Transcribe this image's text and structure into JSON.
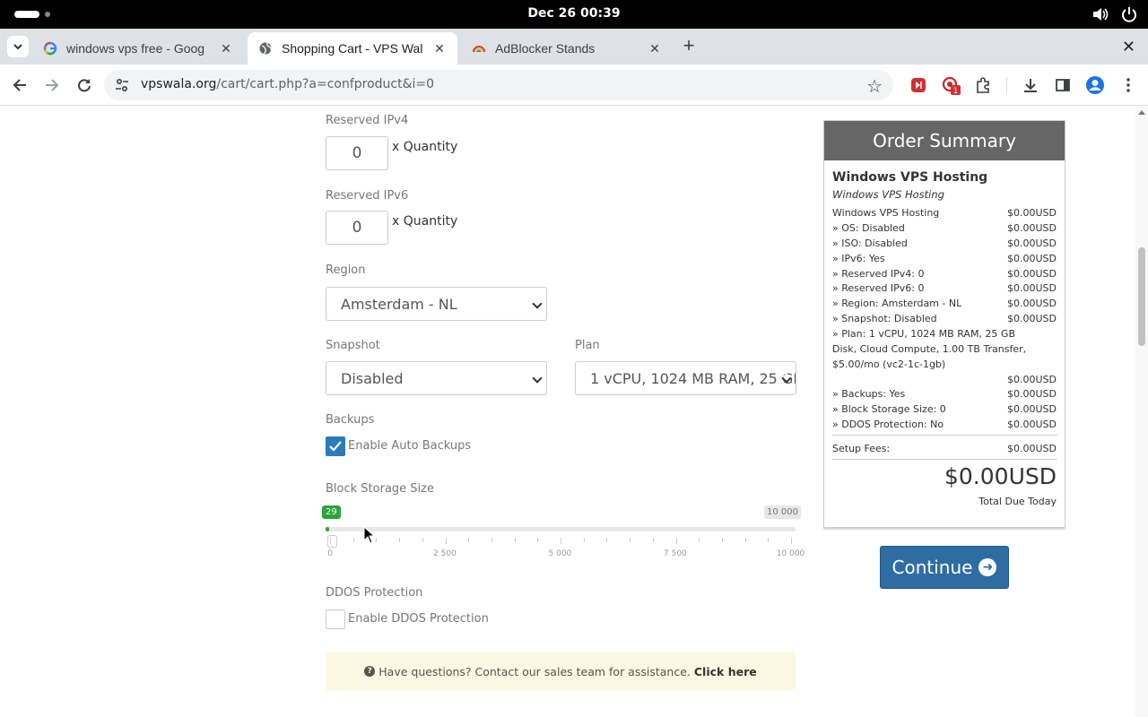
{
  "os": {
    "clock": "Dec 26  00:39"
  },
  "tabs": [
    {
      "title": "windows vps free - Goog",
      "icon": "google-icon"
    },
    {
      "title": "Shopping Cart - VPS Wal",
      "icon": "globe-icon"
    },
    {
      "title": "AdBlocker Stands",
      "icon": "rainbow-icon"
    }
  ],
  "toolbar": {
    "url_host": "vpswala.org",
    "url_path": "/cart/cart.php?a=confproduct&i=0",
    "badge_count": "1"
  },
  "form": {
    "reserved_ipv4": {
      "label": "Reserved IPv4",
      "value": "0",
      "suffix": "x Quantity"
    },
    "reserved_ipv6": {
      "label": "Reserved IPv6",
      "value": "0",
      "suffix": "x Quantity"
    },
    "region": {
      "label": "Region",
      "selected": "Amsterdam - NL"
    },
    "snapshot": {
      "label": "Snapshot",
      "selected": "Disabled"
    },
    "plan": {
      "label": "Plan",
      "selected": "1 vCPU, 1024 MB RAM, 25 GB Disk"
    },
    "backups": {
      "label": "Backups",
      "checkbox_label": "Enable Auto Backups",
      "checked": true
    },
    "block_storage": {
      "label": "Block Storage Size",
      "value": "29",
      "value_num": 29,
      "max_label": "10 000",
      "max_num": 10000,
      "ticks": [
        "0",
        "2 500",
        "5 000",
        "7 500",
        "10 000"
      ]
    },
    "ddos": {
      "label": "DDOS Protection",
      "checkbox_label": "Enable DDOS Protection",
      "checked": false
    }
  },
  "help": {
    "text": "Have questions? Contact our sales team for assistance.",
    "link": "Click here"
  },
  "summary": {
    "title": "Order Summary",
    "product_name": "Windows VPS Hosting",
    "product_group": "Windows VPS Hosting",
    "lines": [
      {
        "desc": "Windows VPS Hosting",
        "price": "$0.00USD"
      },
      {
        "desc": " » OS: Disabled",
        "price": "$0.00USD"
      },
      {
        "desc": " » ISO: Disabled",
        "price": "$0.00USD"
      },
      {
        "desc": " » IPv6: Yes",
        "price": "$0.00USD"
      },
      {
        "desc": " » Reserved IPv4: 0",
        "price": "$0.00USD"
      },
      {
        "desc": " » Reserved IPv6: 0",
        "price": "$0.00USD"
      },
      {
        "desc": " » Region: Amsterdam - NL",
        "price": "$0.00USD"
      },
      {
        "desc": " » Snapshot: Disabled",
        "price": "$0.00USD"
      }
    ],
    "plan_line": {
      "desc": " » Plan: 1 vCPU, 1024 MB RAM, 25 GB Disk, Cloud Compute, 1.00 TB Transfer, $5.00/mo (vc2-1c-1gb)",
      "price": "$0.00USD"
    },
    "lines2": [
      {
        "desc": " » Backups: Yes",
        "price": "$0.00USD"
      },
      {
        "desc": " » Block Storage Size: 0",
        "price": "$0.00USD"
      },
      {
        "desc": " » DDOS Protection: No",
        "price": "$0.00USD"
      }
    ],
    "setup_fees": {
      "desc": "Setup Fees:",
      "price": "$0.00USD"
    },
    "total": "$0.00USD",
    "total_label": "Total Due Today"
  },
  "continue_label": "Continue"
}
